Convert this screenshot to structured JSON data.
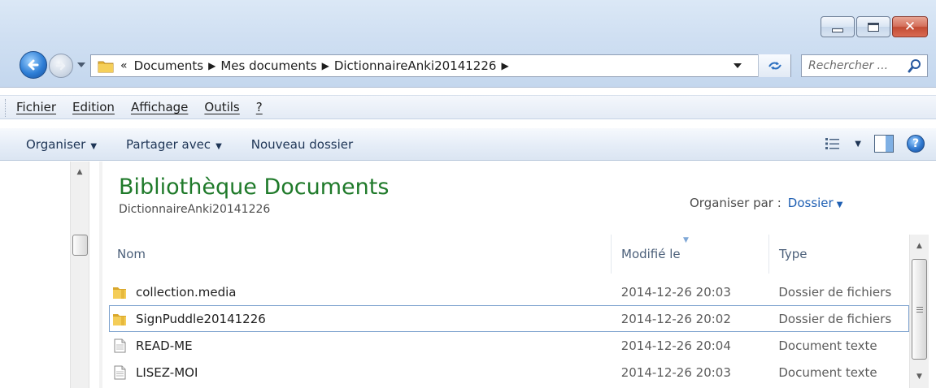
{
  "window": {
    "minimize_glyph": "minimize",
    "maximize_glyph": "maximize",
    "close_label": "✕"
  },
  "address": {
    "overflow": "«",
    "crumbs": [
      "Documents",
      "Mes documents",
      "DictionnaireAnki20141226"
    ]
  },
  "search": {
    "placeholder": "Rechercher ..."
  },
  "menu": {
    "items": [
      "Fichier",
      "Edition",
      "Affichage",
      "Outils",
      "?"
    ]
  },
  "commands": {
    "organise": "Organiser",
    "share": "Partager avec",
    "new_folder": "Nouveau dossier",
    "help": "?"
  },
  "library": {
    "title": "Bibliothèque Documents",
    "subtitle": "DictionnaireAnki20141226",
    "arrange_label": "Organiser par :",
    "arrange_value": "Dossier"
  },
  "columns": {
    "name": "Nom",
    "date": "Modifié le",
    "type": "Type"
  },
  "files": [
    {
      "name": "collection.media",
      "date": "2014-12-26 20:03",
      "type": "Dossier de fichiers",
      "icon": "folder-icon"
    },
    {
      "name": "SignPuddle20141226",
      "date": "2014-12-26 20:02",
      "type": "Dossier de fichiers",
      "icon": "folder-icon"
    },
    {
      "name": "READ-ME",
      "date": "2014-12-26 20:04",
      "type": "Document texte",
      "icon": "text-file-icon"
    },
    {
      "name": "LISEZ-MOI",
      "date": "2014-12-26 20:03",
      "type": "Document texte",
      "icon": "text-file-icon"
    }
  ],
  "colors": {
    "library_title": "#1f7a2a",
    "accent_link": "#1e5fb3",
    "selection_border": "#7da2ce"
  }
}
